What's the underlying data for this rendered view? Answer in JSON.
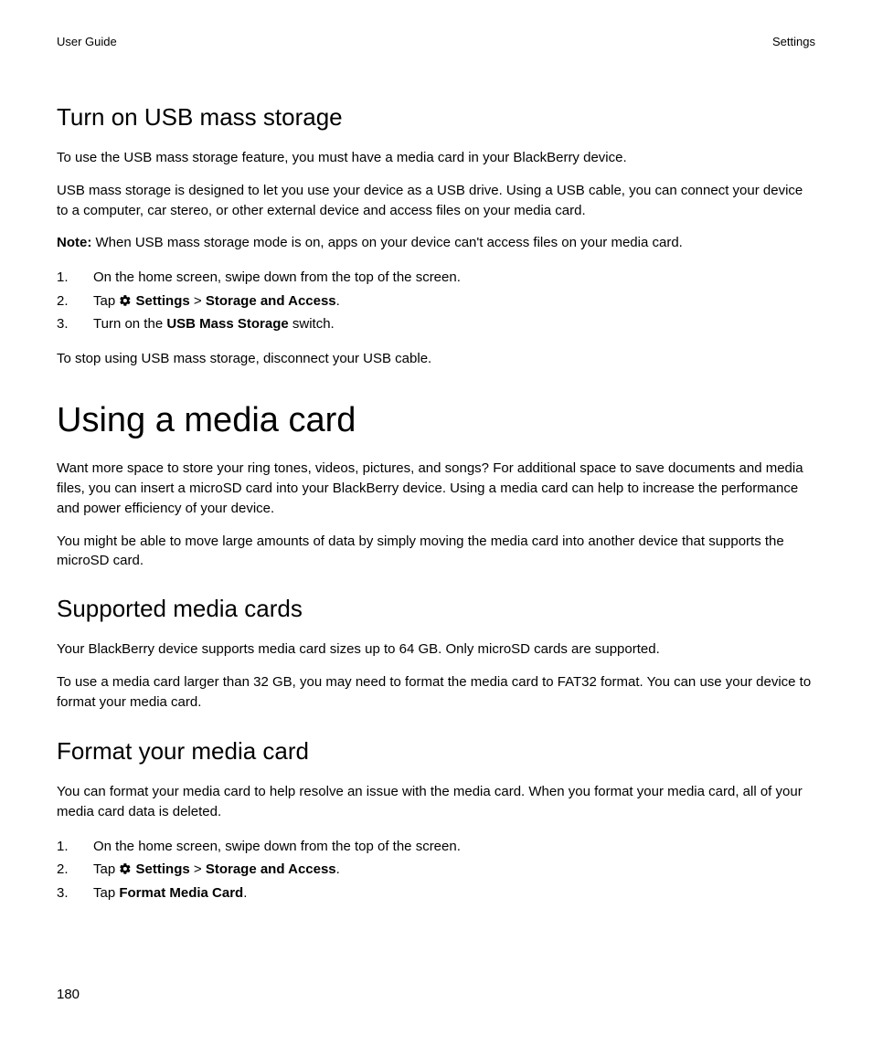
{
  "header": {
    "left": "User Guide",
    "right": "Settings"
  },
  "section1": {
    "title": "Turn on USB mass storage",
    "p1": "To use the USB mass storage feature, you must have a media card in your BlackBerry device.",
    "p2": "USB mass storage is designed to let you use your device as a USB drive. Using a USB cable, you can connect your device to a computer, car stereo, or other external device and access files on your media card.",
    "note_label": "Note:",
    "note_body": " When USB mass storage mode is on, apps on your device can't access files on your media card.",
    "step1": "On the home screen, swipe down from the top of the screen.",
    "step2_pre": "Tap ",
    "step2_settings": " Settings",
    "step2_sep": " > ",
    "step2_path": "Storage and Access",
    "step2_post": ".",
    "step3_pre": "Turn on the ",
    "step3_bold": "USB Mass Storage",
    "step3_post": " switch.",
    "after": "To stop using USB mass storage, disconnect your USB cable."
  },
  "section2": {
    "title": "Using a media card",
    "p1": "Want more space to store your ring tones, videos, pictures, and songs? For additional space to save documents and media files, you can insert a microSD card into your BlackBerry device. Using a media card can help to increase the performance and power efficiency of your device.",
    "p2": "You might be able to move large amounts of data by simply moving the media card into another device that supports the microSD card."
  },
  "section3": {
    "title": "Supported media cards",
    "p1": "Your BlackBerry device supports media card sizes up to 64 GB. Only microSD cards are supported.",
    "p2": "To use a media card larger than 32 GB, you may need to format the media card to FAT32 format. You can use your device to format your media card."
  },
  "section4": {
    "title": "Format your media card",
    "p1": "You can format your media card to help resolve an issue with the media card. When you format your media card, all of your media card data is deleted.",
    "step1": "On the home screen, swipe down from the top of the screen.",
    "step2_pre": "Tap ",
    "step2_settings": " Settings",
    "step2_sep": " > ",
    "step2_path": "Storage and Access",
    "step2_post": ".",
    "step3_pre": "Tap ",
    "step3_bold": "Format Media Card",
    "step3_post": "."
  },
  "page_number": "180"
}
